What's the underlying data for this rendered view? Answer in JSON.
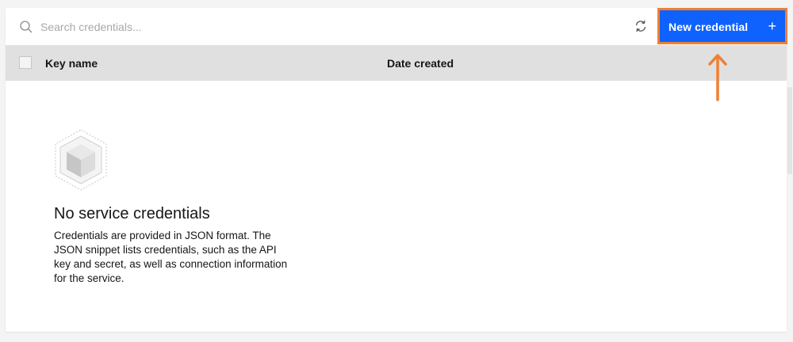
{
  "toolbar": {
    "search": {
      "placeholder": "Search credentials...",
      "icon": "search-icon"
    },
    "refresh_icon": "refresh-icon",
    "new_credential": {
      "label": "New credential",
      "icon": "+"
    }
  },
  "table": {
    "columns": [
      "Key name",
      "Date created"
    ],
    "rows": []
  },
  "empty_state": {
    "icon": "cube-icon",
    "title": "No service credentials",
    "description": "Credentials are provided in JSON format. The JSON snippet lists credentials, such as the API key and secret, as well as connection information for the service."
  },
  "colors": {
    "primary_button": "#0f62fe",
    "highlight": "#f07f33",
    "header_bg": "#e0e0e0"
  }
}
